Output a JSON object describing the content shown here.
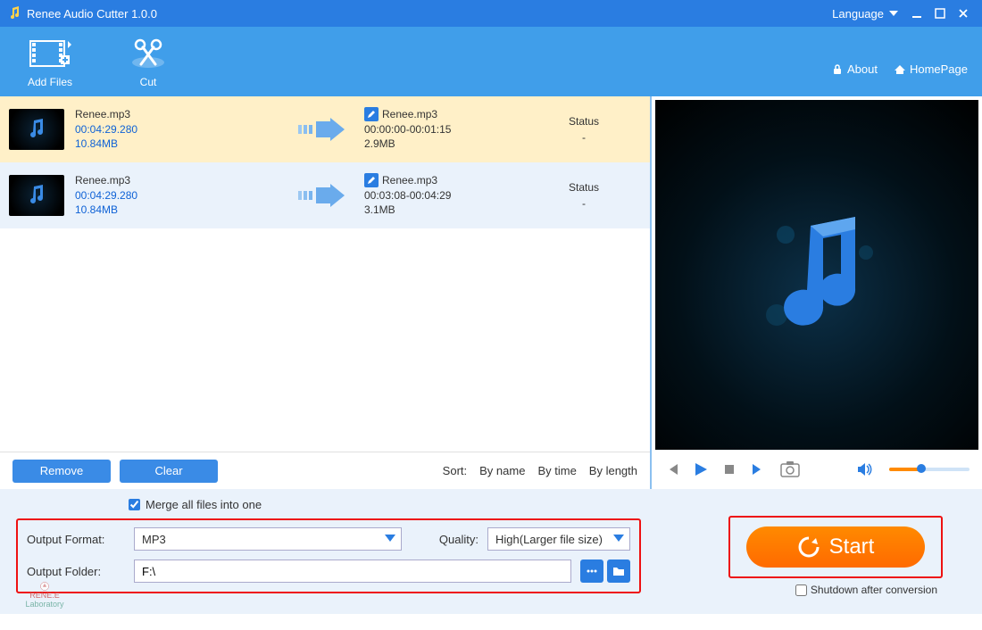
{
  "titlebar": {
    "app_name": "Renee Audio Cutter 1.0.0",
    "language_label": "Language"
  },
  "toolbar": {
    "add_files": "Add Files",
    "cut": "Cut",
    "about": "About",
    "homepage": "HomePage"
  },
  "files": [
    {
      "src_name": "Renee.mp3",
      "src_duration": "00:04:29.280",
      "src_size": "10.84MB",
      "out_name": "Renee.mp3",
      "out_range": "00:00:00-00:01:15",
      "out_size": "2.9MB",
      "status_label": "Status",
      "status_value": "-"
    },
    {
      "src_name": "Renee.mp3",
      "src_duration": "00:04:29.280",
      "src_size": "10.84MB",
      "out_name": "Renee.mp3",
      "out_range": "00:03:08-00:04:29",
      "out_size": "3.1MB",
      "status_label": "Status",
      "status_value": "-"
    }
  ],
  "list_actions": {
    "remove": "Remove",
    "clear": "Clear",
    "sort_label": "Sort:",
    "by_name": "By name",
    "by_time": "By time",
    "by_length": "By length"
  },
  "output": {
    "merge_label": "Merge all files into one",
    "merge_checked": true,
    "format_label": "Output Format:",
    "format_value": "MP3",
    "quality_label": "Quality:",
    "quality_value": "High(Larger file size)",
    "folder_label": "Output Folder:",
    "folder_value": "F:\\",
    "start_label": "Start",
    "shutdown_label": "Shutdown after conversion",
    "shutdown_checked": false
  },
  "vendor": {
    "brand": "RENE.E",
    "sub": "Laboratory"
  }
}
